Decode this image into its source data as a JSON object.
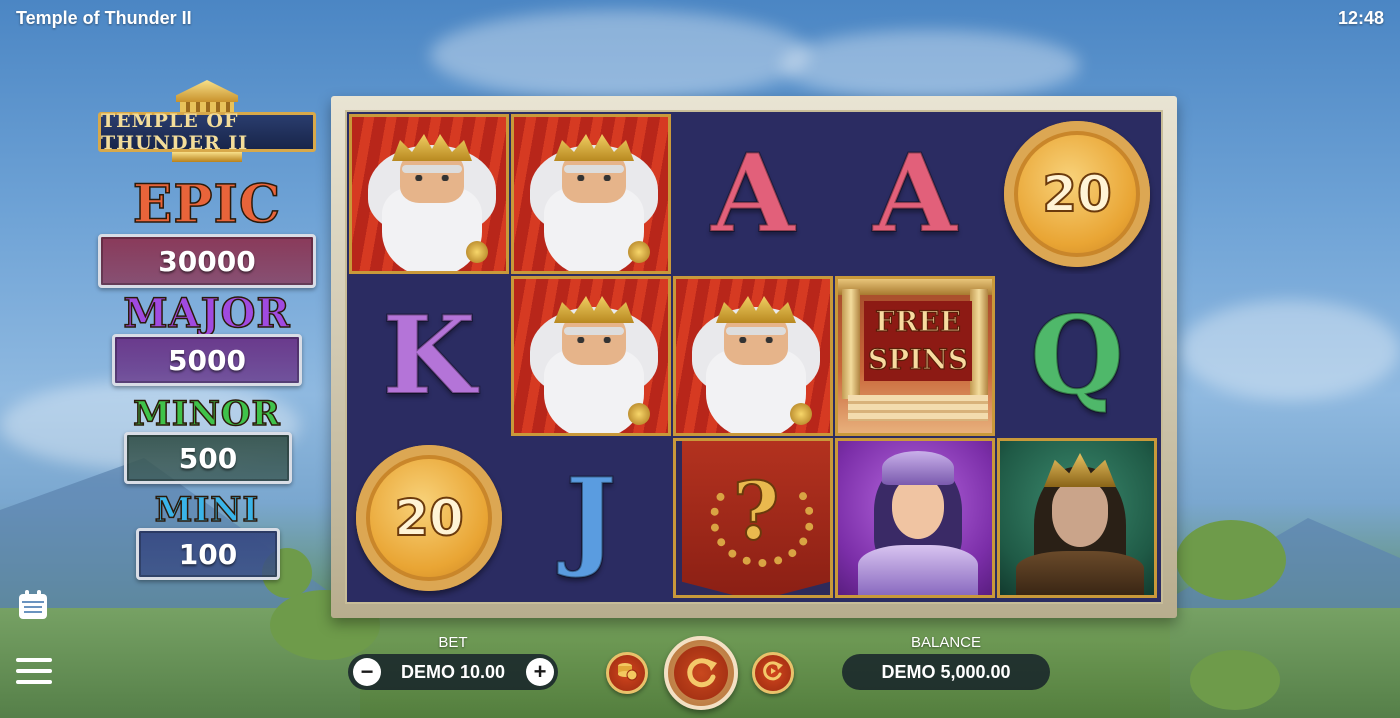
{
  "app": {
    "title": "Temple of Thunder II",
    "time": "12:48"
  },
  "logo": {
    "text": "TEMPLE OF THUNDER II"
  },
  "jackpots": [
    {
      "name": "EPIC",
      "value": "30000",
      "title_color": "#e8643a",
      "box_color": "#8a3a5a"
    },
    {
      "name": "MAJOR",
      "value": "5000",
      "title_color": "#a04ae0",
      "box_color": "#6a3a8c"
    },
    {
      "name": "MINOR",
      "value": "500",
      "title_color": "#3fc24a",
      "box_color": "#3c5a56"
    },
    {
      "name": "MINI",
      "value": "100",
      "title_color": "#3ab4e8",
      "box_color": "#3a4e86"
    }
  ],
  "reels": {
    "rows": [
      [
        {
          "symbol": "zeus",
          "framed": true
        },
        {
          "symbol": "zeus",
          "framed": true
        },
        {
          "symbol": "letter",
          "text": "A",
          "color": "#e2607a"
        },
        {
          "symbol": "letter",
          "text": "A",
          "color": "#e2607a"
        },
        {
          "symbol": "coin",
          "text": "20"
        }
      ],
      [
        {
          "symbol": "letter",
          "text": "K",
          "color": "#b474d8"
        },
        {
          "symbol": "zeus",
          "framed": true
        },
        {
          "symbol": "zeus",
          "framed": true
        },
        {
          "symbol": "free-spins",
          "text": "FREE SPINS",
          "framed": true
        },
        {
          "symbol": "letter",
          "text": "Q",
          "color": "#4fb86a"
        }
      ],
      [
        {
          "symbol": "coin",
          "text": "20"
        },
        {
          "symbol": "letter",
          "text": "J",
          "color": "#5a9ce0"
        },
        {
          "symbol": "mystery",
          "text": "?",
          "framed": true
        },
        {
          "symbol": "athena",
          "framed": true
        },
        {
          "symbol": "hero",
          "framed": true
        }
      ]
    ]
  },
  "controls": {
    "bet_label": "BET",
    "bet_value": "DEMO 10.00",
    "balance_label": "BALANCE",
    "balance_value": "DEMO 5,000.00",
    "minus": "−",
    "plus": "+"
  },
  "icons": {
    "calendar": "calendar-icon",
    "menu": "hamburger-menu-icon",
    "coins": "coin-stack-icon",
    "spin": "spin-icon",
    "autoplay": "autoplay-icon"
  }
}
